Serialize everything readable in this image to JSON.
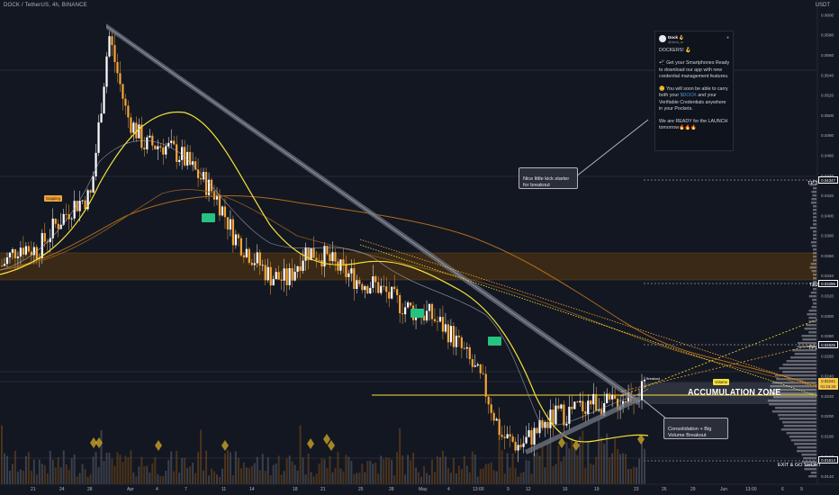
{
  "chart_title": "DOCK / TetherUS, 4h, BINANCE",
  "currency": "USDT",
  "chart_data": {
    "type": "line",
    "title": "DOCK / TetherUS, 4h, BINANCE",
    "y_scale_label": "USDT",
    "y_ticks": [
      0.06,
      0.058,
      0.056,
      0.054,
      0.052,
      0.05,
      0.048,
      0.046,
      0.044,
      0.042,
      0.04,
      0.038,
      0.036,
      0.034,
      0.032,
      0.03,
      0.028,
      0.026,
      0.024,
      0.022,
      0.02,
      0.018,
      0.016,
      0.014
    ],
    "ylim": [
      0.0132,
      0.0604
    ],
    "x_ticks": [
      "21",
      "24",
      "28",
      "Apr",
      "4",
      "7",
      "11",
      "14",
      "18",
      "21",
      "25",
      "28",
      "May",
      "4",
      "13:00",
      "9",
      "12",
      "16",
      "19",
      "23",
      "26",
      "29",
      "Jun",
      "13:00",
      "6",
      "9"
    ],
    "series": [
      {
        "values": [
          0.035,
          0.037,
          0.0365,
          0.039,
          0.041,
          0.042,
          0.058,
          0.05,
          0.047,
          0.047,
          0.046,
          0.044,
          0.042,
          0.038,
          0.036,
          0.034,
          0.0335,
          0.0365,
          0.036,
          0.0345,
          0.0335,
          0.033,
          0.0315,
          0.0305,
          0.03,
          0.0285,
          0.026,
          0.023,
          0.018,
          0.017,
          0.0185,
          0.02,
          0.0205,
          0.0215,
          0.021,
          0.022,
          0.0225
        ]
      }
    ],
    "price_levels": [
      {
        "label": "TP 3",
        "price": 0.04347,
        "tag": "0.04347"
      },
      {
        "label": "TP2",
        "price": 0.03296,
        "tag": "0.03296"
      },
      {
        "label": "TP1",
        "price": 0.02625,
        "tag": "0.02625"
      },
      {
        "label": "EXIT & GO SHORT",
        "price": 0.01614,
        "tag": "0.01614"
      }
    ],
    "current_price": "0.02241",
    "current_price_sub": "01:16:44",
    "annotations": [
      "ACCUMULATION ZONE",
      "Nice little kick starter for breakout",
      "Consolidation + Big Volume Breakout"
    ]
  },
  "tweet": {
    "name": "Dock 🪝",
    "handle": "@dock_io",
    "line1": "DOCKERS! 🪝",
    "line2": "📲 Get your Smartphones Ready to download our app with new credential management features.",
    "line3_pre": "😊 You will soon be able to carry both your ",
    "line3_hl": "$DOCK",
    "line3_post": " and your Verifiable Credentials anywhere in your Pockets.",
    "line4": "We are READY for the LAUNCH tomorrow🔥🔥🔥"
  },
  "labels": {
    "gapping": "Gapping",
    "breakout_tag": "Breakout",
    "volume_tag": "Volume"
  },
  "colors": {
    "background": "#131722",
    "up_candle": "#ffffff",
    "down_candle": "#f7a536",
    "ma_fast": "#f7e13a",
    "ma_slow": "#c67a1e",
    "trendline": "#9598a1",
    "zone": "#4a3318",
    "green_signal": "#26c281"
  }
}
